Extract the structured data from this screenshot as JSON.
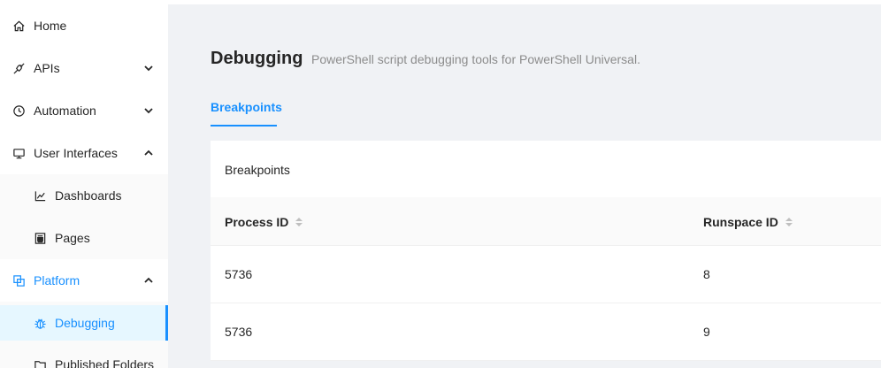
{
  "sidebar": {
    "items": [
      {
        "label": "Home",
        "icon": "home-icon"
      },
      {
        "label": "APIs",
        "icon": "api-icon",
        "expanded": false
      },
      {
        "label": "Automation",
        "icon": "clock-icon",
        "expanded": false
      },
      {
        "label": "User Interfaces",
        "icon": "desktop-icon",
        "expanded": true
      },
      {
        "label": "Dashboards",
        "icon": "line-chart-icon"
      },
      {
        "label": "Pages",
        "icon": "page-icon"
      },
      {
        "label": "Platform",
        "icon": "platform-icon",
        "expanded": true
      },
      {
        "label": "Debugging",
        "icon": "bug-icon",
        "selected": true
      },
      {
        "label": "Published Folders",
        "icon": "folder-icon"
      }
    ]
  },
  "header": {
    "title": "Debugging",
    "subtitle": "PowerShell script debugging tools for PowerShell Universal."
  },
  "tabs": [
    {
      "label": "Breakpoints",
      "active": true
    }
  ],
  "card": {
    "title": "Breakpoints",
    "columns": [
      "Process ID",
      "Runspace ID"
    ],
    "rows": [
      {
        "process_id": "5736",
        "runspace_id": "8"
      },
      {
        "process_id": "5736",
        "runspace_id": "9"
      }
    ]
  },
  "colors": {
    "accent": "#1890ff",
    "background": "#f0f2f5",
    "selected_bg": "#e6f7ff"
  }
}
